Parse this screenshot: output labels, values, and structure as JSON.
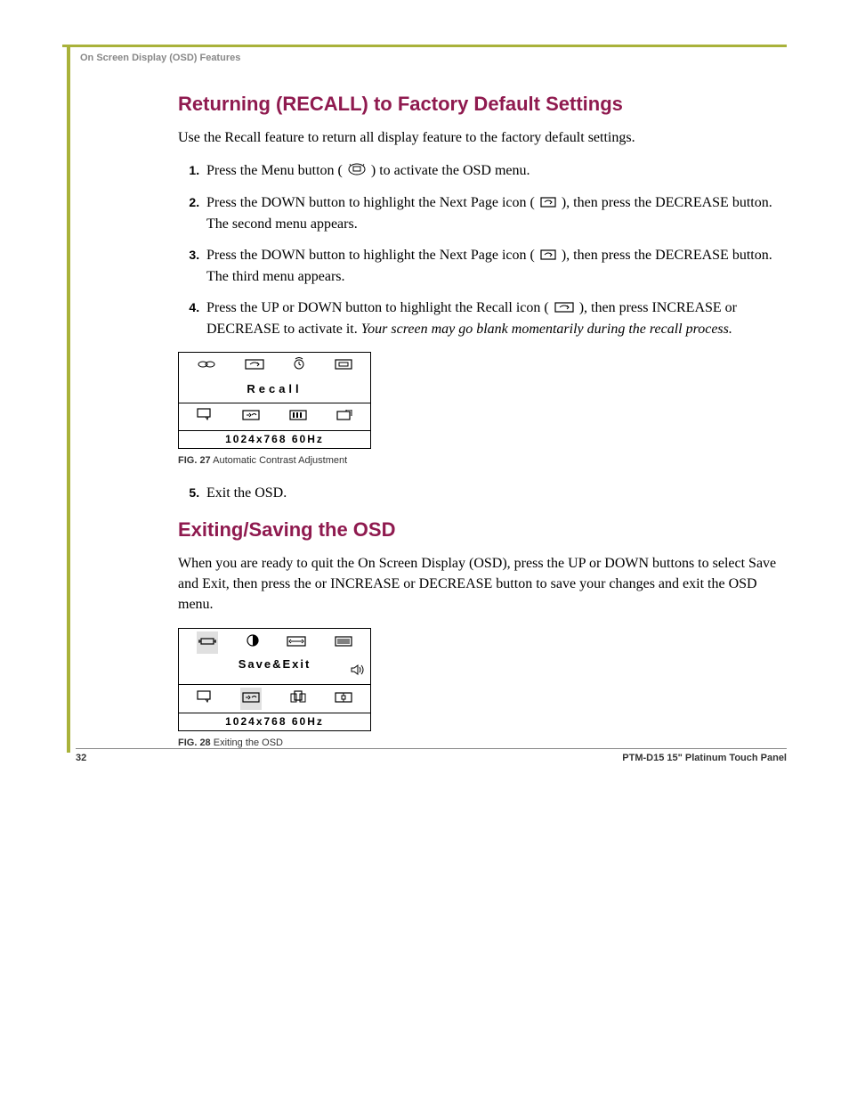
{
  "runningHead": "On Screen Display (OSD) Features",
  "section1": {
    "title": "Returning (RECALL) to Factory Default Settings",
    "intro": "Use the Recall feature to return all display feature to the factory default settings.",
    "steps": {
      "s1a": "Press the Menu button ( ",
      "s1b": ") to activate the OSD menu.",
      "s2a": "Press the DOWN button to highlight the Next Page icon ( ",
      "s2b": "), then press the DECREASE button. The second menu appears.",
      "s3a": "Press the DOWN button to highlight the Next Page icon ( ",
      "s3b": "), then press the DECREASE button. The third menu appears.",
      "s4a": "Press the UP or DOWN button to highlight the Recall icon ( ",
      "s4b": " ), then press INCREASE or DECREASE to activate it. ",
      "s4c": "Your screen may go blank momentarily during the recall process.",
      "s5": "Exit the OSD."
    }
  },
  "osd1": {
    "title": "Recall",
    "status": "1024x768  60Hz"
  },
  "fig27": {
    "label": "FIG. 27",
    "caption": "  Automatic Contrast Adjustment"
  },
  "section2": {
    "title": "Exiting/Saving the OSD",
    "intro": "When you are ready to quit the On Screen Display (OSD), press the UP or DOWN buttons to select Save and Exit, then press the or INCREASE or DECREASE button to save your changes and exit the OSD menu."
  },
  "osd2": {
    "title": "Save&Exit",
    "status": "1024x768  60Hz"
  },
  "fig28": {
    "label": "FIG. 28",
    "caption": "  Exiting the OSD"
  },
  "footer": {
    "page": "32",
    "doc": "PTM-D15 15\" Platinum Touch Panel"
  }
}
